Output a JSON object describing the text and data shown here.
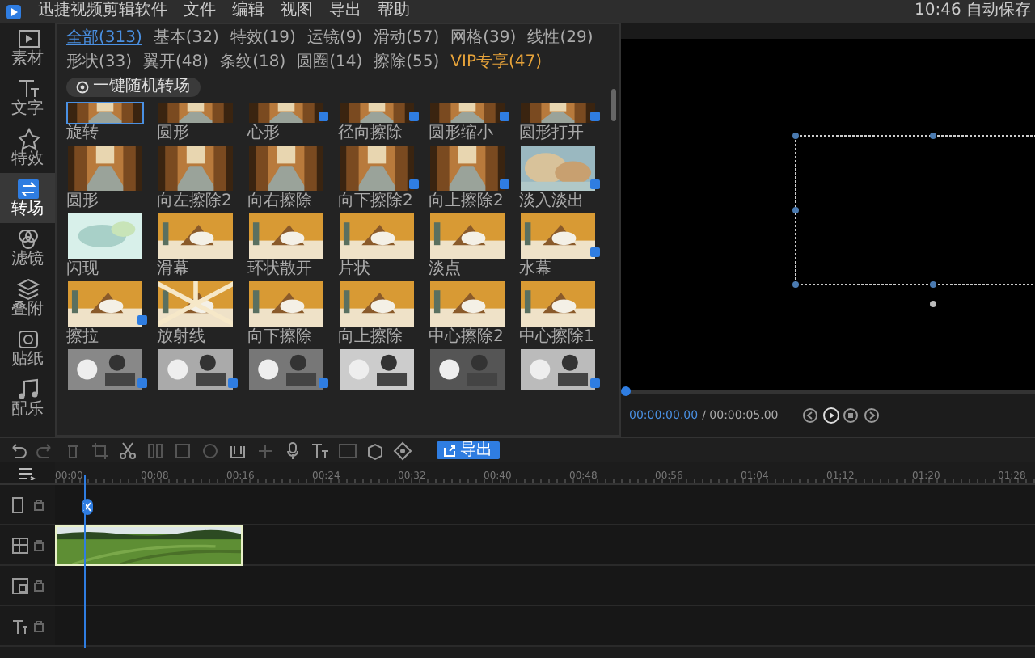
{
  "app": {
    "title": "迅捷视频剪辑软件"
  },
  "menu": [
    "文件",
    "编辑",
    "视图",
    "导出",
    "帮助"
  ],
  "autosave": "10:46 自动保存",
  "sidebar": [
    {
      "label": "素材",
      "kind": "media",
      "selected": false
    },
    {
      "label": "文字",
      "kind": "text",
      "selected": false
    },
    {
      "label": "特效",
      "kind": "effect",
      "selected": false
    },
    {
      "label": "转场",
      "kind": "transition",
      "selected": true
    },
    {
      "label": "滤镜",
      "kind": "filter",
      "selected": false
    },
    {
      "label": "叠附",
      "kind": "overlay",
      "selected": false
    },
    {
      "label": "贴纸",
      "kind": "sticker",
      "selected": false
    },
    {
      "label": "配乐",
      "kind": "music",
      "selected": false
    }
  ],
  "filters": [
    {
      "label": "全部(313)",
      "kind": "normal",
      "selected": true
    },
    {
      "label": "基本(32)",
      "kind": "normal",
      "selected": false
    },
    {
      "label": "特效(19)",
      "kind": "normal",
      "selected": false
    },
    {
      "label": "运镜(9)",
      "kind": "normal",
      "selected": false
    },
    {
      "label": "滑动(57)",
      "kind": "normal",
      "selected": false
    },
    {
      "label": "网格(39)",
      "kind": "normal",
      "selected": false
    },
    {
      "label": "线性(29)",
      "kind": "normal",
      "selected": false
    },
    {
      "label": "形状(33)",
      "kind": "normal",
      "selected": false
    },
    {
      "label": "翼开(48)",
      "kind": "normal",
      "selected": false
    },
    {
      "label": "条纹(18)",
      "kind": "normal",
      "selected": false
    },
    {
      "label": "圆圈(14)",
      "kind": "normal",
      "selected": false
    },
    {
      "label": "擦除(55)",
      "kind": "normal",
      "selected": false
    },
    {
      "label": "VIP专享(47)",
      "kind": "vip",
      "selected": false
    }
  ],
  "random_button": "一键随机转场",
  "transitions": [
    {
      "label": "旋转",
      "vip": false,
      "selected": true
    },
    {
      "label": "圆形",
      "vip": false,
      "selected": false
    },
    {
      "label": "心形",
      "vip": true,
      "selected": false
    },
    {
      "label": "径向擦除",
      "vip": true,
      "selected": false
    },
    {
      "label": "圆形缩小",
      "vip": true,
      "selected": false
    },
    {
      "label": "圆形打开",
      "vip": true,
      "selected": false
    },
    {
      "label": "圆形",
      "vip": false,
      "selected": false
    },
    {
      "label": "向左擦除2",
      "vip": false,
      "selected": false
    },
    {
      "label": "向右擦除",
      "vip": false,
      "selected": false
    },
    {
      "label": "向下擦除2",
      "vip": true,
      "selected": false
    },
    {
      "label": "向上擦除2",
      "vip": true,
      "selected": false
    },
    {
      "label": "淡入淡出",
      "vip": true,
      "selected": false
    },
    {
      "label": "闪现",
      "vip": false,
      "selected": false
    },
    {
      "label": "滑幕",
      "vip": false,
      "selected": false
    },
    {
      "label": "环状散开",
      "vip": false,
      "selected": false
    },
    {
      "label": "片状",
      "vip": false,
      "selected": false
    },
    {
      "label": "淡点",
      "vip": false,
      "selected": false
    },
    {
      "label": "水幕",
      "vip": true,
      "selected": false
    },
    {
      "label": "擦拉",
      "vip": true,
      "selected": false
    },
    {
      "label": "放射线",
      "vip": false,
      "selected": false
    },
    {
      "label": "向下擦除",
      "vip": false,
      "selected": false
    },
    {
      "label": "向上擦除",
      "vip": false,
      "selected": false
    },
    {
      "label": "中心擦除2",
      "vip": false,
      "selected": false
    },
    {
      "label": "中心擦除1",
      "vip": false,
      "selected": false
    },
    {
      "vip": true,
      "selected": false
    },
    {
      "vip": true,
      "selected": false
    },
    {
      "vip": true,
      "selected": false
    },
    {
      "vip": false,
      "selected": false
    },
    {
      "vip": false,
      "selected": false
    },
    {
      "vip": true,
      "selected": false
    }
  ],
  "preview": {
    "current_time": "00:00:00.00",
    "total_time": "/ 00:00:05.00",
    "level": 0
  },
  "export_button": "导出",
  "ruler": [
    "00:00",
    "00:08",
    "00:16",
    "00:24",
    "00:32",
    "00:40",
    "00:48",
    "00:56",
    "01:04",
    "01:12",
    "01:20",
    "01:28"
  ],
  "tracks": [
    {
      "kind": "effect",
      "transition": true,
      "clip": false
    },
    {
      "kind": "video",
      "transition": false,
      "clip": true
    },
    {
      "kind": "pip",
      "transition": false,
      "clip": false
    },
    {
      "kind": "text",
      "transition": false,
      "clip": false
    }
  ]
}
